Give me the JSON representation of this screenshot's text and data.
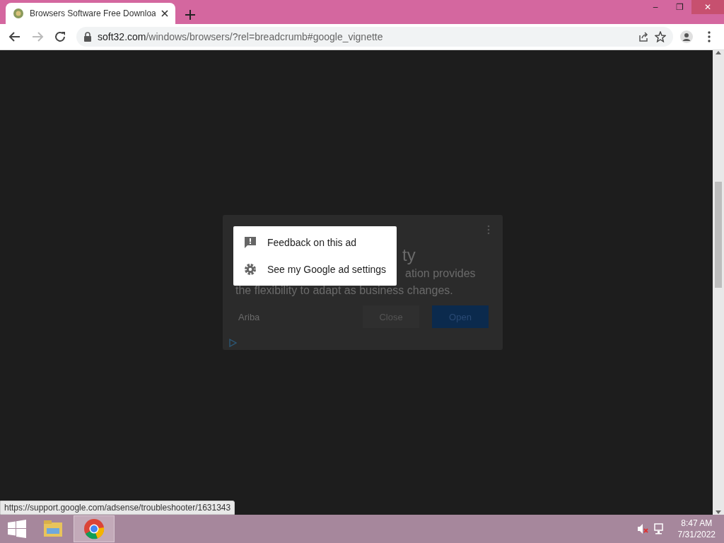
{
  "window": {
    "tab_title": "Browsers Software Free Downloa",
    "controls": [
      "–",
      "❐",
      "✕"
    ]
  },
  "toolbar": {
    "url_host": "soft32.com",
    "url_path": "/windows/browsers/?rel=breadcrumb#google_vignette"
  },
  "ad": {
    "heading": "ty",
    "body_line_1": "ation provides",
    "body_line_2": "the flexibility to adapt as business changes.",
    "brand": "Ariba",
    "buttons": [
      {
        "label": "Close",
        "kind": "secondary"
      },
      {
        "label": "Open",
        "kind": "primary"
      }
    ]
  },
  "ad_menu": {
    "items": [
      {
        "label": "Feedback on this ad",
        "kind": "feedback"
      },
      {
        "label": "See my Google ad settings",
        "kind": "settings"
      }
    ]
  },
  "status_url": "https://support.google.com/adsense/troubleshooter/1631343",
  "taskbar": {
    "apps": [
      {
        "kind": "files",
        "selected": false
      },
      {
        "kind": "chrome",
        "selected": true
      }
    ],
    "time": "8:47 AM",
    "date": "7/31/2022"
  }
}
